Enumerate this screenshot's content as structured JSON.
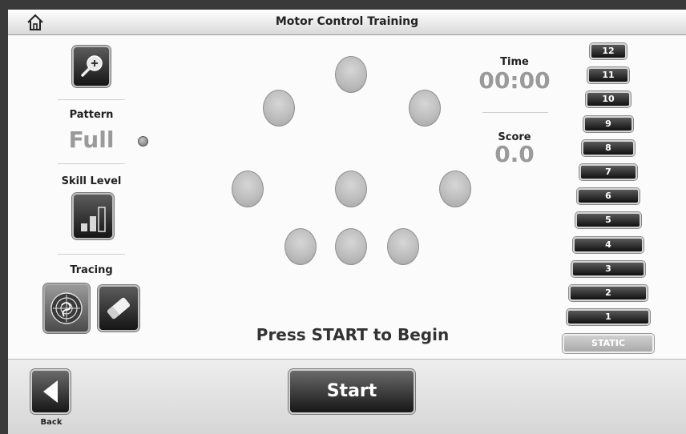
{
  "window": {
    "title": "Motor Control Training"
  },
  "left_panel": {
    "pattern_label": "Pattern",
    "pattern_value": "Full",
    "skill_label": "Skill Level",
    "tracing_label": "Tracing"
  },
  "stats": {
    "time_label": "Time",
    "time_value": "00:00",
    "score_label": "Score",
    "score_value": "0.0"
  },
  "prompt": "Press START to Begin",
  "levels": [
    "12",
    "11",
    "10",
    "9",
    "8",
    "7",
    "6",
    "5",
    "4",
    "3",
    "2",
    "1"
  ],
  "static_label": "STATIC",
  "footer": {
    "start_label": "Start",
    "back_label": "Back"
  },
  "icons": {
    "home": "home-icon",
    "zoom": "zoom-in-icon",
    "skill": "signal-bars-icon",
    "tracing": "target-icon",
    "eraser": "eraser-icon",
    "back": "triangle-left-icon"
  }
}
